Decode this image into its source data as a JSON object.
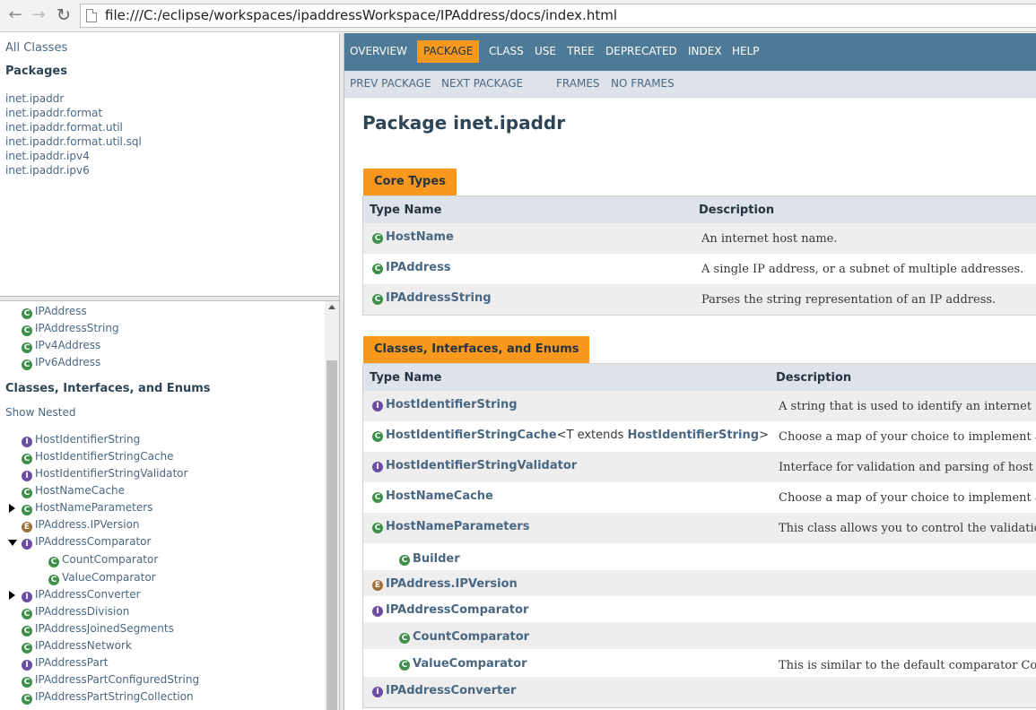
{
  "browser": {
    "url": "file:///C:/eclipse/workspaces/ipaddressWorkspace/IPAddress/docs/index.html",
    "back_icon": "back-arrow-icon",
    "forward_icon": "forward-arrow-icon",
    "reload_icon": "reload-icon"
  },
  "packages_frame": {
    "all_classes": "All Classes",
    "heading": "Packages",
    "packages": [
      "inet.ipaddr",
      "inet.ipaddr.format",
      "inet.ipaddr.format.util",
      "inet.ipaddr.format.util.sql",
      "inet.ipaddr.ipv4",
      "inet.ipaddr.ipv6"
    ]
  },
  "classes_frame": {
    "core_items": [
      {
        "label": "IPAddress",
        "kind": "C"
      },
      {
        "label": "IPAddressString",
        "kind": "C"
      },
      {
        "label": "IPv4Address",
        "kind": "C"
      },
      {
        "label": "IPv6Address",
        "kind": "C"
      }
    ],
    "heading": "Classes, Interfaces, and Enums",
    "show_nested": "Show Nested",
    "items": [
      {
        "label": "HostIdentifierString",
        "kind": "I"
      },
      {
        "label": "HostIdentifierStringCache",
        "kind": "C"
      },
      {
        "label": "HostIdentifierStringValidator",
        "kind": "I"
      },
      {
        "label": "HostNameCache",
        "kind": "C"
      },
      {
        "label": "HostNameParameters",
        "kind": "C"
      },
      {
        "label": "IPAddress.IPVersion",
        "kind": "E"
      },
      {
        "label": "IPAddressComparator",
        "kind": "I"
      },
      {
        "label": "CountComparator",
        "kind": "C"
      },
      {
        "label": "ValueComparator",
        "kind": "C"
      },
      {
        "label": "IPAddressConverter",
        "kind": "I"
      },
      {
        "label": "IPAddressDivision",
        "kind": "C"
      },
      {
        "label": "IPAddressJoinedSegments",
        "kind": "C"
      },
      {
        "label": "IPAddressNetwork",
        "kind": "C"
      },
      {
        "label": "IPAddressPart",
        "kind": "I"
      },
      {
        "label": "IPAddressPartConfiguredString",
        "kind": "C"
      },
      {
        "label": "IPAddressPartStringCollection",
        "kind": "C"
      }
    ]
  },
  "content": {
    "topnav": [
      "OVERVIEW",
      "PACKAGE",
      "CLASS",
      "USE",
      "TREE",
      "DEPRECATED",
      "INDEX",
      "HELP"
    ],
    "topnav_active": "PACKAGE",
    "subnav": [
      "PREV PACKAGE",
      "NEXT PACKAGE",
      "FRAMES",
      "NO FRAMES"
    ],
    "title": "Package inet.ipaddr",
    "core_table": {
      "caption": "Core Types",
      "col_name": "Type Name",
      "col_desc": "Description",
      "rows": [
        {
          "name": "HostName",
          "kind": "C",
          "desc": "An internet host name."
        },
        {
          "name": "IPAddress",
          "kind": "C",
          "desc": "A single IP address, or a subnet of multiple addresses."
        },
        {
          "name": "IPAddressString",
          "kind": "C",
          "desc": "Parses the string representation of an IP address."
        }
      ]
    },
    "classes_table": {
      "caption": "Classes, Interfaces, and Enums",
      "col_name": "Type Name",
      "col_desc": "Description",
      "rows": [
        {
          "name": "HostIdentifierString",
          "kind": "I",
          "desc": "A string that is used to identify an internet"
        },
        {
          "name": "HostIdentifierStringCache",
          "kind": "C",
          "generic_prefix": "<T extends ",
          "generic_type": "HostIdentifierString",
          "generic_suffix": ">",
          "desc": "Choose a map of your choice to implement a"
        },
        {
          "name": "HostIdentifierStringValidator",
          "kind": "I",
          "desc": "Interface for validation and parsing of host"
        },
        {
          "name": "HostNameCache",
          "kind": "C",
          "desc": "Choose a map of your choice to implement a"
        },
        {
          "name": "HostNameParameters",
          "kind": "C",
          "desc": "This class allows you to control the validatio"
        },
        {
          "name": "Builder",
          "kind": "C",
          "desc": ""
        },
        {
          "name": "IPAddress.IPVersion",
          "kind": "E",
          "desc": ""
        },
        {
          "name": "IPAddressComparator",
          "kind": "I",
          "desc": ""
        },
        {
          "name": "CountComparator",
          "kind": "C",
          "desc": ""
        },
        {
          "name": "ValueComparator",
          "kind": "C",
          "desc": "This is similar to the default comparator Co"
        },
        {
          "name": "IPAddressConverter",
          "kind": "I",
          "desc": ""
        }
      ]
    }
  }
}
